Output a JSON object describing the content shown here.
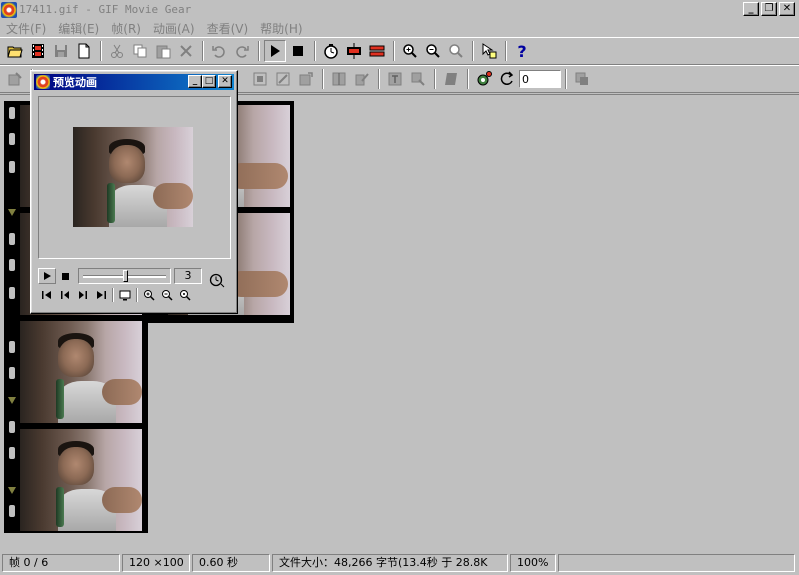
{
  "window": {
    "title": "17411.gif - GIF Movie Gear",
    "btn_min": "_",
    "btn_max": "❐",
    "btn_close": "✕"
  },
  "menu": [
    {
      "label": "文件",
      "key": "(F)"
    },
    {
      "label": "编辑",
      "key": "(E)"
    },
    {
      "label": "帧",
      "key": "(R)"
    },
    {
      "label": "动画",
      "key": "(A)"
    },
    {
      "label": "查看",
      "key": "(V)"
    },
    {
      "label": "帮助",
      "key": "(H)"
    }
  ],
  "toolbar2": {
    "rotation_value": "0"
  },
  "preview": {
    "title": "预览动画",
    "btn_min": "_",
    "btn_max": "□",
    "btn_close": "✕",
    "frame_number": "3",
    "slider_fraction": 0.5
  },
  "status": {
    "frame": "帧  0 / 6",
    "size": "120 ×100",
    "time": "0.60 秒",
    "filesize": "文件大小：48,266 字节(13.4秒 于 28.8K",
    "zoom": "100%"
  },
  "colors": {
    "titlebar_active": "#000080",
    "face": "#c0c0c0"
  }
}
